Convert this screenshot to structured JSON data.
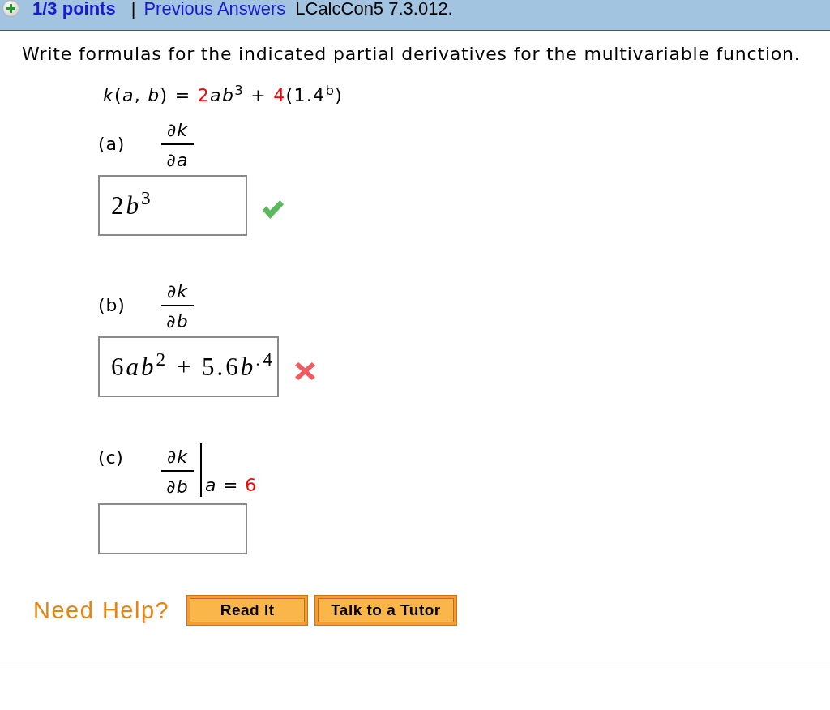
{
  "header": {
    "score": "1/3 points",
    "separator": "|",
    "link": "Previous Answers",
    "question_id": "LCalcCon5 7.3.012."
  },
  "instruction": "Write formulas for the indicated partial derivatives for the multivariable function.",
  "function": [
    {
      "text": "*k*(*a*, *b*) = ",
      "color": "#000000"
    },
    {
      "text": "2",
      "color": "#ff0000"
    },
    {
      "text": "*ab*$^{3}$ + ",
      "color": "#000000"
    },
    {
      "text": "4",
      "color": "#ff0000"
    },
    {
      "text": "(1.4$^{b}$)",
      "color": "#000000"
    }
  ],
  "parts": [
    {
      "label": "(a)",
      "numerator": "∂k",
      "denominator": "∂a",
      "answer": [
        "2",
        "*b*$^{3}$"
      ],
      "correct": true
    },
    {
      "label": "(b)",
      "numerator": "∂k",
      "denominator": "∂b",
      "answer": [
        "6",
        "*ab*$^{2}$ + 5.6",
        "*b*$^{.4}$"
      ],
      "correct": false
    },
    {
      "label": "(c)",
      "numerator": "∂k",
      "denominator": "∂b",
      "evaluated_at": [
        {
          "text": "*a* = ",
          "color": "#000000"
        },
        {
          "text": "6",
          "color": "#ff0000"
        }
      ]
    }
  ],
  "help": {
    "label": "Need Help?",
    "buttons": [
      "Read It",
      "Talk to a Tutor"
    ]
  }
}
